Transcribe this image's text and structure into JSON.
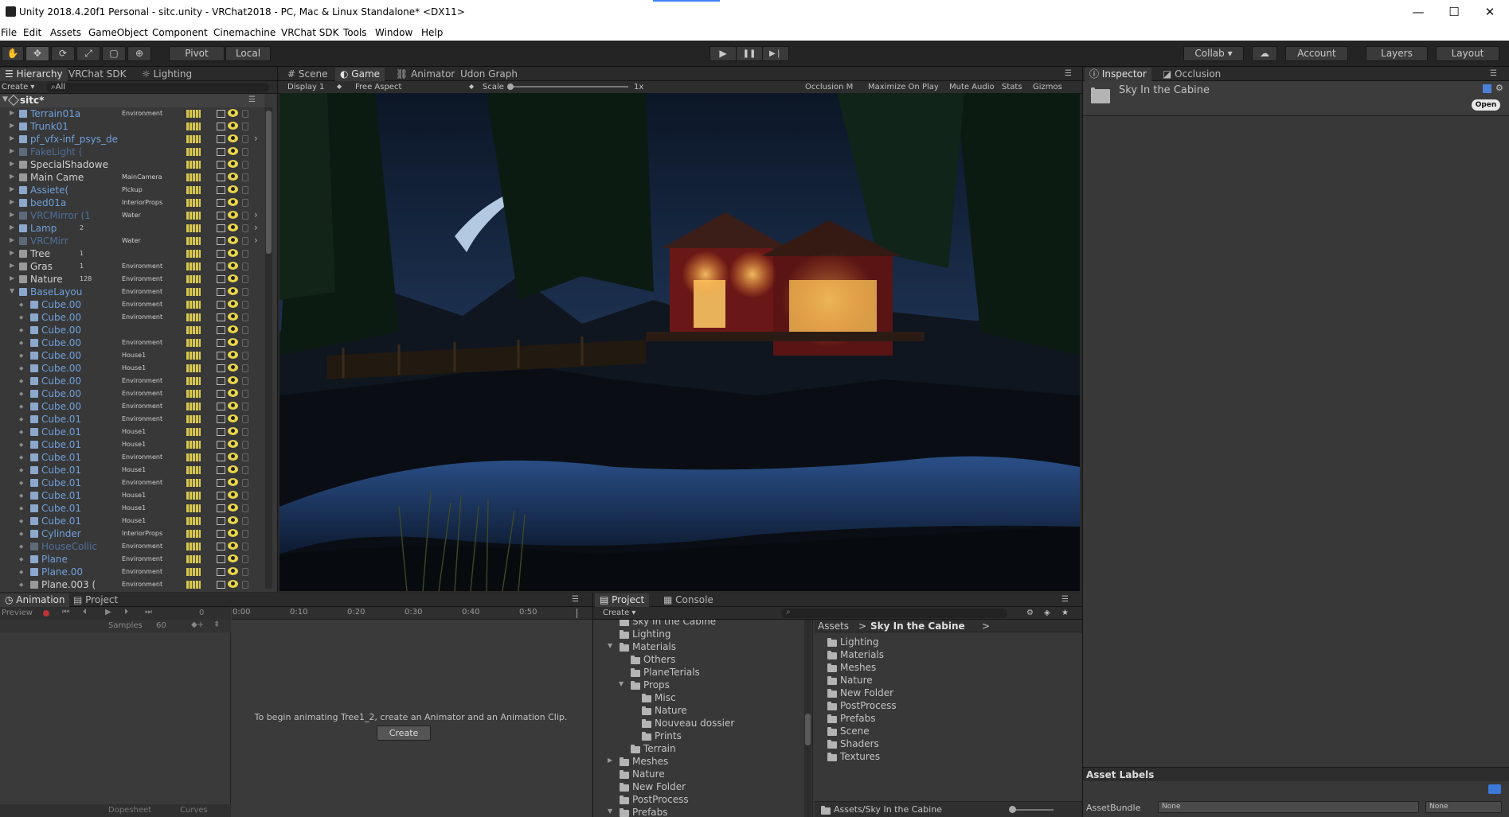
{
  "window": {
    "title": "Unity 2018.4.20f1 Personal - sitc.unity - VRChat2018 - PC, Mac & Linux Standalone* <DX11>",
    "minimize": "—",
    "maximize": "☐",
    "close": "✕"
  },
  "menu": [
    "File",
    "Edit",
    "Assets",
    "GameObject",
    "Component",
    "Cinemachine",
    "VRChat SDK",
    "Tools",
    "Window",
    "Help"
  ],
  "toolbar": {
    "pivot": "Pivot",
    "local": "Local",
    "play": "▶",
    "pause": "❚❚",
    "step": "▶❘",
    "collab": "Collab ▾",
    "account": "Account",
    "layers": "Layers",
    "layout": "Layout"
  },
  "hierarchy": {
    "tabs": [
      "Hierarchy",
      "VRChat SDK",
      "Lighting"
    ],
    "create": "Create ▾",
    "search_placeholder": "All",
    "scene_name": "sitc*",
    "rows": [
      {
        "name": "Terrain01a",
        "tag": "Environment",
        "num": "",
        "color": "#6fa0dc"
      },
      {
        "name": "Trunk01",
        "tag": "",
        "num": "",
        "color": "#6fa0dc"
      },
      {
        "name": "pf_vfx-inf_psys_demo_loop_firac",
        "tag": "",
        "num": "",
        "color": "#6fa0dc"
      },
      {
        "name": "FakeLight (",
        "tag": "",
        "num": "",
        "color": "#4f6f9a"
      },
      {
        "name": "SpecialShadowe",
        "tag": "",
        "num": "",
        "color": "#d0d0d0"
      },
      {
        "name": "Main Came",
        "tag": "MainCamera",
        "num": "",
        "color": "#d0d0d0"
      },
      {
        "name": "Assiete(",
        "tag": "Pickup",
        "num": "",
        "color": "#6fa0dc"
      },
      {
        "name": "bed01a",
        "tag": "InteriorProps",
        "num": "",
        "color": "#6fa0dc"
      },
      {
        "name": "VRCMirror (1",
        "tag": "Water",
        "num": "",
        "color": "#4f6f9a"
      },
      {
        "name": "Lamp",
        "tag": "",
        "num": "2",
        "color": "#6fa0dc"
      },
      {
        "name": "VRCMirr",
        "tag": "Water",
        "num": "",
        "color": "#4f6f9a"
      },
      {
        "name": "Tree",
        "tag": "",
        "num": "1",
        "color": "#d0d0d0"
      },
      {
        "name": "Gras",
        "tag": "Environment",
        "num": "1",
        "color": "#d0d0d0"
      },
      {
        "name": "Nature",
        "tag": "Environment",
        "num": "128",
        "color": "#d0d0d0"
      },
      {
        "name": "BaseLayou",
        "tag": "Environment",
        "num": "",
        "color": "#6fa0dc"
      },
      {
        "name": "Cube.00",
        "tag": "Environment",
        "num": "",
        "color": "#6fa0dc"
      },
      {
        "name": "Cube.00",
        "tag": "Environment",
        "num": "",
        "color": "#6fa0dc"
      },
      {
        "name": "Cube.00",
        "tag": "",
        "num": "",
        "color": "#6fa0dc"
      },
      {
        "name": "Cube.00",
        "tag": "Environment",
        "num": "",
        "color": "#6fa0dc"
      },
      {
        "name": "Cube.00",
        "tag": "House1",
        "num": "",
        "color": "#6fa0dc"
      },
      {
        "name": "Cube.00",
        "tag": "House1",
        "num": "",
        "color": "#6fa0dc"
      },
      {
        "name": "Cube.00",
        "tag": "Environment",
        "num": "",
        "color": "#6fa0dc"
      },
      {
        "name": "Cube.00",
        "tag": "Environment",
        "num": "",
        "color": "#6fa0dc"
      },
      {
        "name": "Cube.00",
        "tag": "Environment",
        "num": "",
        "color": "#6fa0dc"
      },
      {
        "name": "Cube.01",
        "tag": "Environment",
        "num": "",
        "color": "#6fa0dc"
      },
      {
        "name": "Cube.01",
        "tag": "House1",
        "num": "",
        "color": "#6fa0dc"
      },
      {
        "name": "Cube.01",
        "tag": "House1",
        "num": "",
        "color": "#6fa0dc"
      },
      {
        "name": "Cube.01",
        "tag": "Environment",
        "num": "",
        "color": "#6fa0dc"
      },
      {
        "name": "Cube.01",
        "tag": "House1",
        "num": "",
        "color": "#6fa0dc"
      },
      {
        "name": "Cube.01",
        "tag": "Environment",
        "num": "",
        "color": "#6fa0dc"
      },
      {
        "name": "Cube.01",
        "tag": "House1",
        "num": "",
        "color": "#6fa0dc"
      },
      {
        "name": "Cube.01",
        "tag": "House1",
        "num": "",
        "color": "#6fa0dc"
      },
      {
        "name": "Cube.01",
        "tag": "House1",
        "num": "",
        "color": "#6fa0dc"
      },
      {
        "name": "Cylinder",
        "tag": "InteriorProps",
        "num": "",
        "color": "#6fa0dc"
      },
      {
        "name": "HouseCollic",
        "tag": "Environment",
        "num": "",
        "color": "#4f6f9a"
      },
      {
        "name": "Plane",
        "tag": "Environment",
        "num": "",
        "color": "#6fa0dc"
      },
      {
        "name": "Plane.00",
        "tag": "Environment",
        "num": "",
        "color": "#6fa0dc"
      },
      {
        "name": "Plane.003 (",
        "tag": "Environment",
        "num": "",
        "color": "#d0d0d0"
      }
    ]
  },
  "scene": {
    "tabs": [
      "Scene",
      "Game",
      "Animator",
      "Udon Graph"
    ],
    "display": "Display 1",
    "aspect": "Free Aspect",
    "scale_label": "Scale",
    "scale_value": "1x",
    "right_items": [
      "Occlusion M",
      "Maximize On Play",
      "Mute Audio",
      "Stats",
      "Gizmos"
    ]
  },
  "inspector": {
    "tabs": [
      "Inspector",
      "Occlusion"
    ],
    "asset_name": "Sky In the Cabine",
    "open_button": "Open",
    "asset_labels": "Asset Labels",
    "assetbundle_label": "AssetBundle",
    "assetbundle_value": "None",
    "variant_value": "None"
  },
  "animation": {
    "tabs": [
      "Animation",
      "Project"
    ],
    "preview": "Preview",
    "frame": "0",
    "samples_label": "Samples",
    "samples_value": "60",
    "timeline": [
      "0:00",
      "0:10",
      "0:20",
      "0:30",
      "0:40",
      "0:50"
    ],
    "message": "To begin animating Tree1_2, create an Animator and an Animation Clip.",
    "create_button": "Create",
    "dopesheet": "Dopesheet",
    "curves": "Curves"
  },
  "project": {
    "tabs": [
      "Project",
      "Console"
    ],
    "create": "Create ▾",
    "search_placeholder": "",
    "tree": [
      {
        "label": "Sky In the Cabine",
        "depth": 1,
        "arrow": ""
      },
      {
        "label": "Lighting",
        "depth": 1,
        "arrow": ""
      },
      {
        "label": "Materials",
        "depth": 1,
        "arrow": "▼"
      },
      {
        "label": "Others",
        "depth": 2,
        "arrow": ""
      },
      {
        "label": "PlaneTerials",
        "depth": 2,
        "arrow": ""
      },
      {
        "label": "Props",
        "depth": 2,
        "arrow": "▼"
      },
      {
        "label": "Misc",
        "depth": 3,
        "arrow": ""
      },
      {
        "label": "Nature",
        "depth": 3,
        "arrow": ""
      },
      {
        "label": "Nouveau dossier",
        "depth": 3,
        "arrow": ""
      },
      {
        "label": "Prints",
        "depth": 3,
        "arrow": ""
      },
      {
        "label": "Terrain",
        "depth": 2,
        "arrow": ""
      },
      {
        "label": "Meshes",
        "depth": 1,
        "arrow": "▶"
      },
      {
        "label": "Nature",
        "depth": 1,
        "arrow": ""
      },
      {
        "label": "New Folder",
        "depth": 1,
        "arrow": ""
      },
      {
        "label": "PostProcess",
        "depth": 1,
        "arrow": ""
      },
      {
        "label": "Prefabs",
        "depth": 1,
        "arrow": "▼"
      }
    ],
    "breadcrumb_root": "Assets",
    "breadcrumb_sep": ">",
    "breadcrumb_current": "Sky In the Cabine",
    "folders": [
      "Lighting",
      "Materials",
      "Meshes",
      "Nature",
      "New Folder",
      "PostProcess",
      "Prefabs",
      "Scene",
      "Shaders",
      "Textures"
    ],
    "path": "Assets/Sky In the Cabine"
  }
}
